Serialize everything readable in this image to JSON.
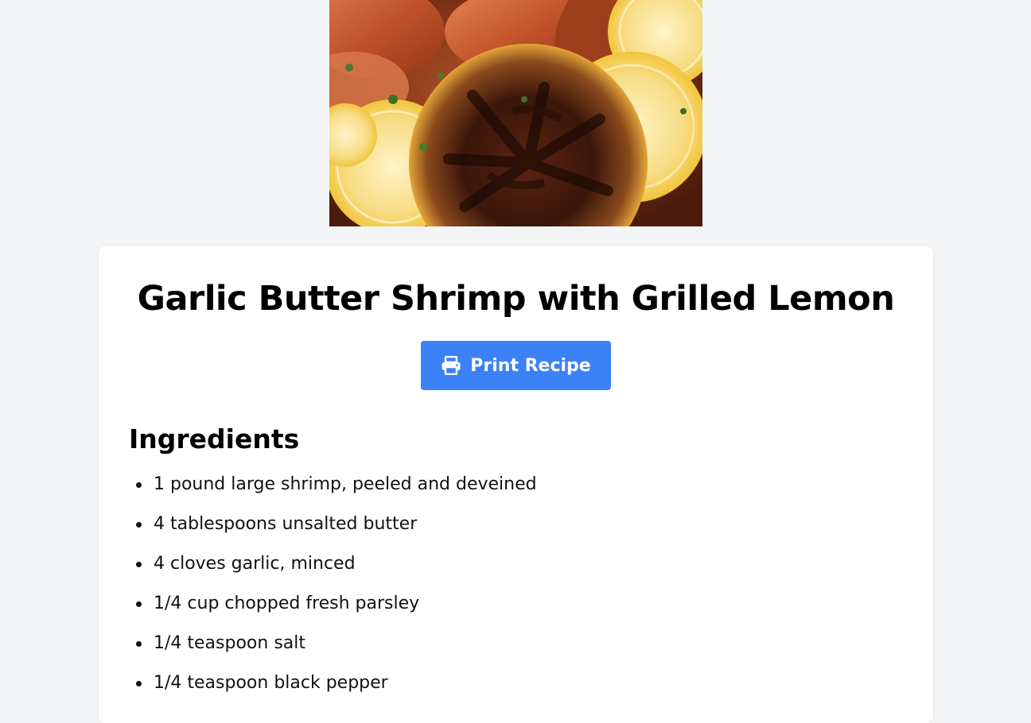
{
  "recipe": {
    "title": "Garlic Butter Shrimp with Grilled Lemon",
    "print_button_label": "Print Recipe",
    "print_icon": "printer-icon",
    "hero_image": "photo of garlic butter shrimp with grilled lemon slices"
  },
  "ingredients": {
    "heading": "Ingredients",
    "items": [
      "1 pound large shrimp, peeled and deveined",
      "4 tablespoons unsalted butter",
      "4 cloves garlic, minced",
      "1/4 cup chopped fresh parsley",
      "1/4 teaspoon salt",
      "1/4 teaspoon black pepper"
    ]
  },
  "colors": {
    "page_background": "#f3f4f6",
    "card_background": "#ffffff",
    "button_accent": "#3b82f6",
    "button_text": "#ffffff"
  }
}
